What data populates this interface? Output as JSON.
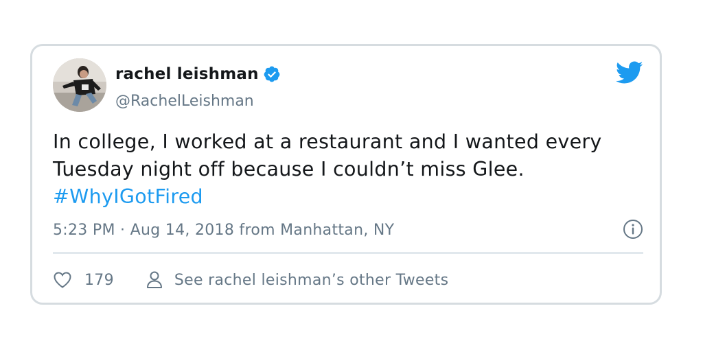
{
  "tweet": {
    "author": {
      "name": "rachel leishman",
      "handle": "@RachelLeishman",
      "verified": true,
      "avatar_icon": "profile-photo"
    },
    "text_before_hashtag": "In college, I worked at a restaurant and I wanted every Tuesday night off because I couldn’t miss Glee. ",
    "hashtag": "#WhyIGotFired",
    "timestamp": "5:23 PM · Aug 14, 2018 from Manhattan, NY",
    "likes": "179",
    "other_tweets_label": "See rachel leishman’s other Tweets",
    "icons": {
      "brand": "twitter-bird-icon",
      "verified": "verified-badge-icon",
      "info": "info-icon",
      "like": "heart-icon",
      "profile": "person-icon"
    }
  },
  "colors": {
    "accent": "#1d9bf0",
    "text": "#14171a",
    "secondary": "#657786",
    "border": "#d6dce0"
  }
}
